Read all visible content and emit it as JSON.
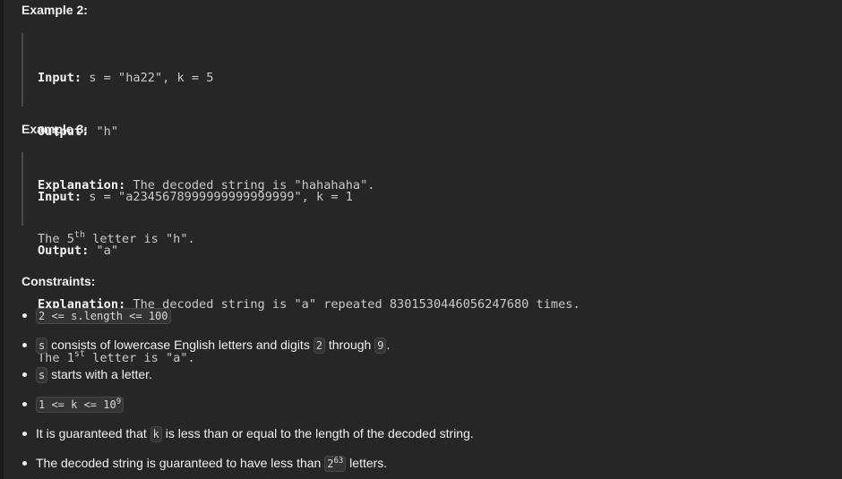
{
  "example2": {
    "heading": "Example 2:",
    "input_label": "Input:",
    "input_value": " s = \"ha22\", k = 5",
    "output_label": "Output:",
    "output_value": " \"h\"",
    "explanation_label": "Explanation:",
    "explanation_value": " The decoded string is \"hahahaha\".",
    "line4_prefix": "The 5",
    "line4_sup": "th",
    "line4_suffix": " letter is \"h\"."
  },
  "example3": {
    "heading": "Example 3:",
    "input_label": "Input:",
    "input_value": " s = \"a2345678999999999999999\", k = 1",
    "output_label": "Output:",
    "output_value": " \"a\"",
    "explanation_label": "Explanation:",
    "explanation_value": " The decoded string is \"a\" repeated 8301530446056247680 times.",
    "line4_prefix": "The 1",
    "line4_sup": "st",
    "line4_suffix": " letter is \"a\"."
  },
  "constraints": {
    "heading": "Constraints:",
    "c1_code": "2 <= s.length <= 100",
    "c2_code_s": "s",
    "c2_text1": " consists of lowercase English letters and digits ",
    "c2_code_2": "2",
    "c2_text2": " through ",
    "c2_code_9": "9",
    "c2_text3": ".",
    "c3_code_s": "s",
    "c3_text": " starts with a letter.",
    "c4_code": "1 <= k <= 10",
    "c4_sup": "9",
    "c5_text1": "It is guaranteed that ",
    "c5_code_k": "k",
    "c5_text2": " is less than or equal to the length of the decoded string.",
    "c6_text1": "The decoded string is guaranteed to have less than ",
    "c6_code": "2",
    "c6_sup": "63",
    "c6_text2": " letters."
  }
}
